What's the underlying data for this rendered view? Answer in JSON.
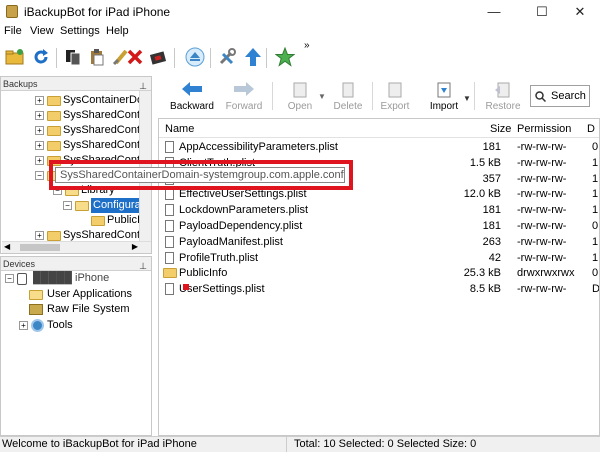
{
  "window": {
    "title": "iBackupBot for iPad iPhone",
    "minimize": "—",
    "maximize": "☐",
    "close": "✕"
  },
  "menu": [
    "File",
    "View",
    "Settings",
    "Help"
  ],
  "toolbar": {
    "overflow": "»"
  },
  "backups": {
    "header": "Backups",
    "pin": "⊥",
    "items": [
      "SysContainerDon",
      "SysSharedContai",
      "SysSharedContai",
      "SysSharedContai",
      "SysSharedContai",
      "Library",
      "Configurati",
      "PublicIr",
      "SysSharedContai"
    ]
  },
  "devices": {
    "header": "Devices",
    "pin": "⊥",
    "device_name": "█████ iPhone",
    "items": [
      "User Applications",
      "Raw File System",
      "Tools"
    ]
  },
  "file_toolbar": {
    "backward": "Backward",
    "forward": "Forward",
    "open": "Open",
    "delete": "Delete",
    "export": "Export",
    "import": "Import",
    "restore": "Restore",
    "search_label": "Search"
  },
  "file_list": {
    "columns": {
      "name": "Name",
      "size": "Size",
      "permission": "Permission",
      "d": "D"
    },
    "rows": [
      {
        "name": "AppAccessibilityParameters.plist",
        "size": "181",
        "permission": "-rw-rw-rw-",
        "d": "0",
        "type": "file"
      },
      {
        "name": "ClientTruth.plist",
        "size": "1.5 kB",
        "permission": "-rw-rw-rw-",
        "d": "1",
        "type": "file"
      },
      {
        "name": "",
        "size": "357",
        "permission": "-rw-rw-rw-",
        "d": "1",
        "type": "file"
      },
      {
        "name": "EffectiveUserSettings.plist",
        "size": "12.0 kB",
        "permission": "-rw-rw-rw-",
        "d": "1",
        "type": "file"
      },
      {
        "name": "LockdownParameters.plist",
        "size": "181",
        "permission": "-rw-rw-rw-",
        "d": "1",
        "type": "file"
      },
      {
        "name": "PayloadDependency.plist",
        "size": "181",
        "permission": "-rw-rw-rw-",
        "d": "0",
        "type": "file"
      },
      {
        "name": "PayloadManifest.plist",
        "size": "263",
        "permission": "-rw-rw-rw-",
        "d": "1",
        "type": "file"
      },
      {
        "name": "ProfileTruth.plist",
        "size": "42",
        "permission": "-rw-rw-rw-",
        "d": "1",
        "type": "file"
      },
      {
        "name": "PublicInfo",
        "size": "25.3 kB",
        "permission": "drwxrwxrwx",
        "d": "0",
        "type": "folder"
      },
      {
        "name": "UserSettings.plist",
        "size": "8.5 kB",
        "permission": "-rw-rw-rw-",
        "d": "D",
        "type": "file"
      }
    ]
  },
  "tooltip": "SysSharedContainerDomain-systemgroup.com.apple.configurationprofiles",
  "status": {
    "left": "Welcome to iBackupBot for iPad iPhone",
    "right": "Total: 10 Selected: 0 Selected Size: 0"
  },
  "colors": {
    "highlight": "#e0141e",
    "folder": "#f2cd6a",
    "accent": "#1e6fc7"
  }
}
